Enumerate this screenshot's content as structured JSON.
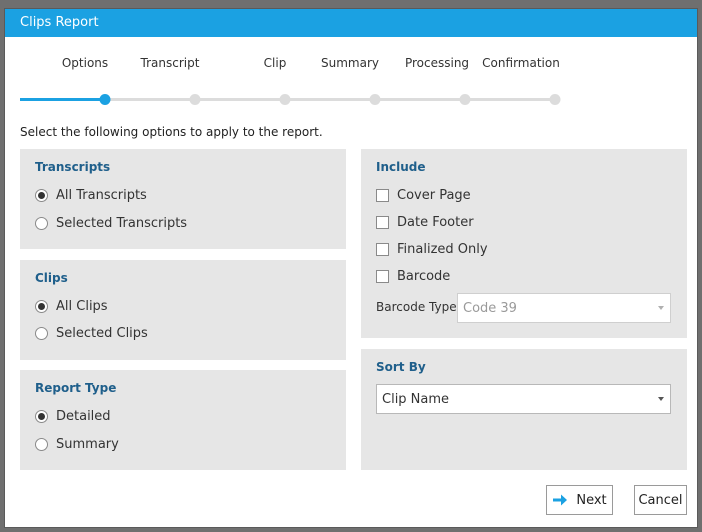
{
  "window": {
    "title": "Clips Report"
  },
  "steps": [
    {
      "label": "Options",
      "active": true
    },
    {
      "label": "Transcript",
      "active": false
    },
    {
      "label": "Clip",
      "active": false
    },
    {
      "label": "Summary",
      "active": false
    },
    {
      "label": "Processing",
      "active": false
    },
    {
      "label": "Confirmation",
      "active": false
    }
  ],
  "intro_text": "Select the following options to apply to the report.",
  "transcripts": {
    "title": "Transcripts",
    "options": [
      {
        "label": "All Transcripts",
        "checked": true
      },
      {
        "label": "Selected Transcripts",
        "checked": false
      }
    ]
  },
  "clips": {
    "title": "Clips",
    "options": [
      {
        "label": "All Clips",
        "checked": true
      },
      {
        "label": "Selected Clips",
        "checked": false
      }
    ]
  },
  "report_type": {
    "title": "Report Type",
    "options": [
      {
        "label": "Detailed",
        "checked": true
      },
      {
        "label": "Summary",
        "checked": false
      }
    ]
  },
  "include": {
    "title": "Include",
    "options": [
      {
        "label": "Cover Page",
        "checked": false
      },
      {
        "label": "Date Footer",
        "checked": false
      },
      {
        "label": "Finalized Only",
        "checked": false
      },
      {
        "label": "Barcode",
        "checked": false
      }
    ],
    "barcode_type_label": "Barcode Type",
    "barcode_type_value": "Code 39"
  },
  "sort_by": {
    "title": "Sort By",
    "value": "Clip Name"
  },
  "buttons": {
    "next": "Next",
    "cancel": "Cancel"
  },
  "colors": {
    "accent": "#1ba1e2",
    "panel_bg": "#e6e6e6",
    "section_title": "#1f5f8b"
  },
  "icons": {
    "next": "arrow-right-icon"
  }
}
